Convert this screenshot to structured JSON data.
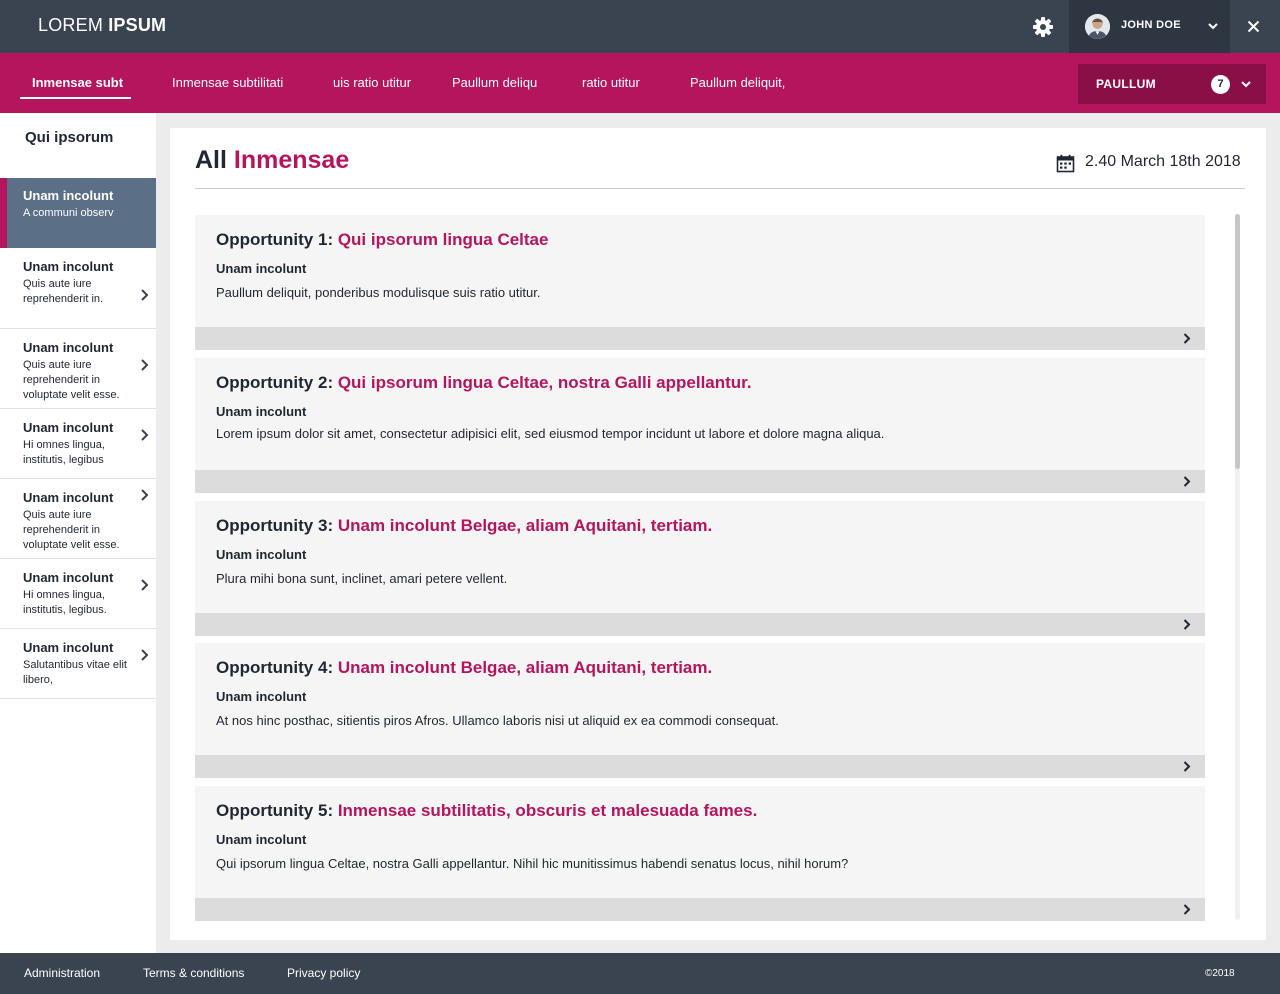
{
  "header": {
    "brand_light": "LOREM ",
    "brand_bold": "IPSUM",
    "user_name": "JOHN DOE"
  },
  "nav": {
    "tabs": [
      {
        "label": "Inmensae subt"
      },
      {
        "label": "Inmensae subtilitati"
      },
      {
        "label": "uis ratio utitur"
      },
      {
        "label": "Paullum deliqu"
      },
      {
        "label": "ratio utitur"
      },
      {
        "label": "Paullum deliquit,"
      }
    ],
    "select_label": "PAULLUM",
    "badge": "7"
  },
  "sidebar": {
    "title": "Qui ipsorum",
    "items": [
      {
        "title": "Unam incolunt",
        "sub": "A communi observ"
      },
      {
        "title": "Unam incolunt",
        "sub": "Quis aute iure reprehenderit in."
      },
      {
        "title": "Unam incolunt",
        "sub": "Quis aute iure reprehenderit in voluptate velit esse."
      },
      {
        "title": "Unam incolunt",
        "sub": "Hi omnes lingua, institutis, legibus"
      },
      {
        "title": "Unam incolunt",
        "sub": "Quis aute iure reprehenderit in voluptate velit esse."
      },
      {
        "title": "Unam incolunt",
        "sub": "Hi omnes lingua, institutis, legibus."
      },
      {
        "title": "Unam incolunt",
        "sub": "Salutantibus vitae elit libero,"
      }
    ]
  },
  "main": {
    "title_plain": "All ",
    "title_accent": "Inmensae",
    "date": "2.40 March 18th 2018",
    "cards": [
      {
        "prefix": "Opportunity 1: ",
        "title": "Qui ipsorum lingua Celtae",
        "sub": "Unam incolunt",
        "body": "Paullum deliquit, ponderibus modulisque suis ratio utitur."
      },
      {
        "prefix": "Opportunity 2: ",
        "title": "Qui ipsorum lingua Celtae, nostra Galli appellantur.",
        "sub": "Unam incolunt",
        "body": "Lorem ipsum dolor sit amet, consectetur adipisici elit, sed eiusmod tempor incidunt ut labore et dolore magna aliqua."
      },
      {
        "prefix": "Opportunity 3: ",
        "title": "Unam incolunt Belgae, aliam Aquitani, tertiam.",
        "sub": "Unam incolunt",
        "body": "Plura mihi bona sunt, inclinet, amari petere vellent."
      },
      {
        "prefix": "Opportunity 4: ",
        "title": "Unam incolunt Belgae, aliam Aquitani, tertiam.",
        "sub": "Unam incolunt",
        "body": "At nos hinc posthac, sitientis piros Afros. Ullamco laboris nisi ut aliquid ex ea commodi consequat."
      },
      {
        "prefix": "Opportunity 5: ",
        "title": "Inmensae subtilitatis, obscuris et malesuada fames.",
        "sub": "Unam incolunt",
        "body": "Qui ipsorum lingua Celtae, nostra Galli appellantur. Nihil hic munitissimus habendi senatus locus, nihil horum?"
      }
    ]
  },
  "footer": {
    "links": [
      {
        "label": "Administration"
      },
      {
        "label": "Terms & conditions"
      },
      {
        "label": "Privacy policy"
      }
    ],
    "copyright": "©2018"
  },
  "icons": {
    "settings": "gear-icon",
    "user_menu": "chevron-down-icon",
    "close": "close-icon",
    "calendar": "calendar-icon",
    "expand": "chevron-right-icon"
  },
  "colors": {
    "header": "#3a4451",
    "accent": "#b5155d",
    "accent_dark": "#8a0f47",
    "sidebar_active": "#5b6f86"
  }
}
